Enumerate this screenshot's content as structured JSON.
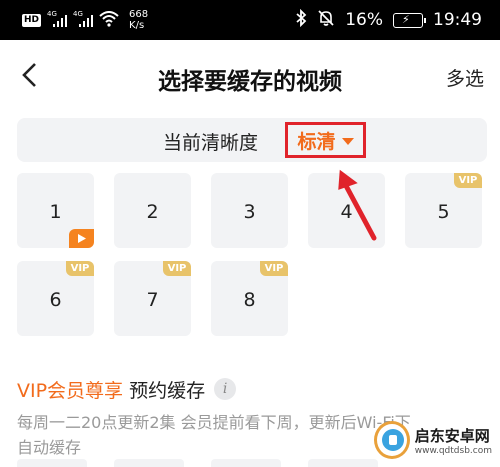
{
  "status_bar": {
    "hd": "HD",
    "signal1_tag": "4G",
    "signal2_tag": "4G",
    "net_speed_value": "668",
    "net_speed_unit": "K/s",
    "battery_percent": "16%",
    "time": "19:49"
  },
  "nav": {
    "title": "选择要缓存的视频",
    "multi_select": "多选"
  },
  "quality": {
    "label": "当前清晰度",
    "value": "标清"
  },
  "episodes": [
    {
      "number": "1",
      "badge": "play"
    },
    {
      "number": "2",
      "badge": ""
    },
    {
      "number": "3",
      "badge": ""
    },
    {
      "number": "4",
      "badge": ""
    },
    {
      "number": "5",
      "badge": "VIP"
    },
    {
      "number": "6",
      "badge": "VIP"
    },
    {
      "number": "7",
      "badge": "VIP"
    },
    {
      "number": "8",
      "badge": "VIP"
    }
  ],
  "vip_section": {
    "title": "VIP会员尊享",
    "subtitle": "预约缓存",
    "info_icon": "i",
    "description": "每周一二20点更新2集 会员提前看下周，更新后Wi-Fi下自动缓存"
  },
  "watermark": {
    "name": "启东安卓网",
    "url": "www.qdtdsb.com"
  },
  "colors": {
    "accent_orange": "#f26b1c",
    "highlight_red": "#e0232b",
    "vip_gold": "#e8c36a",
    "tile_bg": "#f2f3f5"
  },
  "icons": {
    "back": "chevron-left-icon",
    "dropdown": "caret-down-icon",
    "play": "play-icon",
    "info": "info-icon",
    "wifi": "wifi-icon",
    "bluetooth": "bluetooth-icon",
    "mute": "bell-off-icon",
    "battery": "battery-charging-icon"
  }
}
